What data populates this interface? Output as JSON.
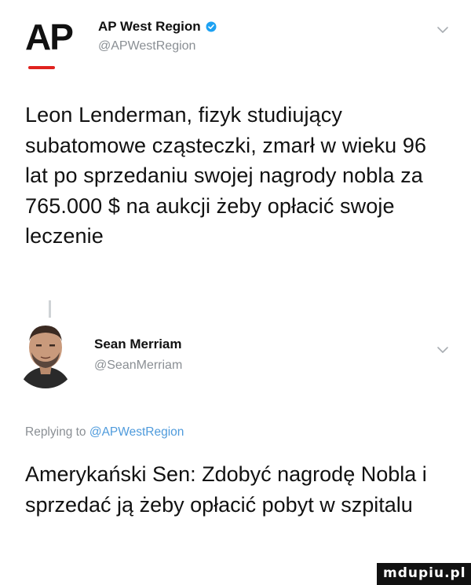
{
  "tweet": {
    "logo_text": "AP",
    "author_name": "AP West Region",
    "author_handle": "@APWestRegion",
    "text": "Leon Lenderman, fizyk studiujący subatomowe cząsteczki, zmarł w wieku 96 lat po sprzedaniu swojej nagrody nobla za 765.000 $ na aukcji żeby opłacić swoje leczenie"
  },
  "reply": {
    "author_name": "Sean Merriam",
    "author_handle": "@SeanMerriam",
    "replying_prefix": "Replying to ",
    "replying_mention": "@APWestRegion",
    "text": "Amerykański Sen: Zdobyć nagrodę Nobla i sprzedać ją żeby opłacić pobyt w szpitalu"
  },
  "watermark": {
    "text": "mdupiu.pl"
  },
  "colors": {
    "ap_red": "#e0221f",
    "verified_blue": "#1da1f2",
    "mention_blue": "#4f9bdc",
    "muted_gray": "#8a8f94"
  },
  "icons": [
    "ap-logo",
    "verified-icon",
    "chevron-down-icon",
    "avatar"
  ]
}
